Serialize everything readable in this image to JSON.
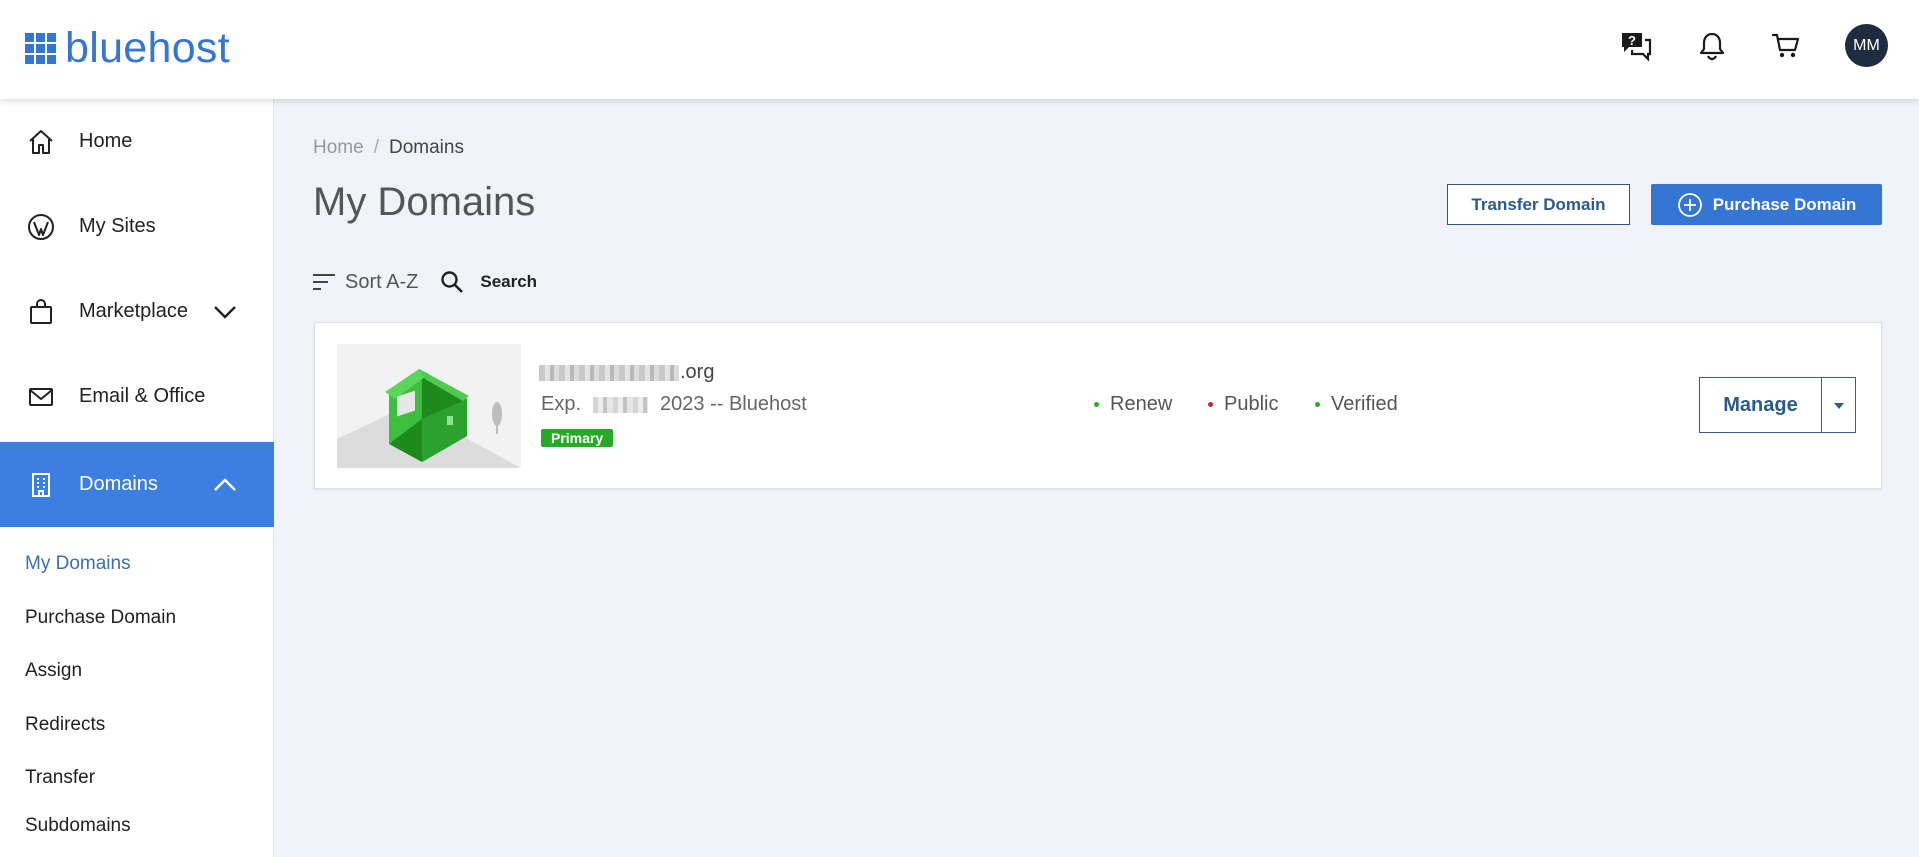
{
  "brand": {
    "name": "bluehost"
  },
  "header": {
    "avatar_initials": "MM"
  },
  "sidebar": {
    "items": [
      {
        "label": "Home"
      },
      {
        "label": "My Sites"
      },
      {
        "label": "Marketplace"
      },
      {
        "label": "Email & Office"
      },
      {
        "label": "Domains"
      }
    ],
    "subitems": [
      {
        "label": "My Domains"
      },
      {
        "label": "Purchase Domain"
      },
      {
        "label": "Assign"
      },
      {
        "label": "Redirects"
      },
      {
        "label": "Transfer"
      },
      {
        "label": "Subdomains"
      }
    ]
  },
  "breadcrumb": {
    "home": "Home",
    "separator": "/",
    "current": "Domains"
  },
  "page": {
    "title": "My Domains",
    "transfer_label": "Transfer Domain",
    "purchase_label": "Purchase Domain"
  },
  "toolbar": {
    "sort_label": "Sort A-Z",
    "search_label": "Search"
  },
  "domain": {
    "name_suffix": ".org",
    "exp_prefix": "Exp.",
    "exp_suffix": "2023 -- Bluehost",
    "badge": "Primary",
    "statuses": [
      {
        "label": "Renew",
        "color": "#2aa82a"
      },
      {
        "label": "Public",
        "color": "#c0282d"
      },
      {
        "label": "Verified",
        "color": "#2aa82a"
      }
    ],
    "manage_label": "Manage"
  },
  "colors": {
    "brand_blue": "#3575d3",
    "active_nav": "#3d7fe0",
    "dark_navy": "#1f2b3e"
  }
}
